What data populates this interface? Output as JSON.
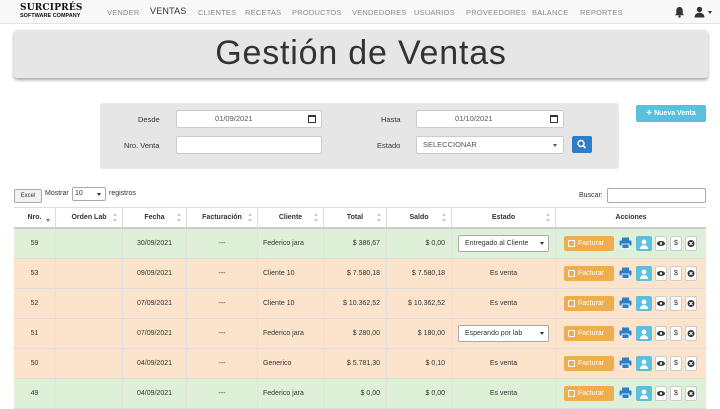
{
  "brand": {
    "name": "SURCIPRÉS",
    "tagline": "SOFTWARE COMPANY"
  },
  "nav": {
    "items": [
      {
        "label": "VENDER",
        "active": false
      },
      {
        "label": "VENTAS",
        "active": true
      },
      {
        "label": "CLIENTES",
        "active": false
      },
      {
        "label": "RECETAS",
        "active": false
      },
      {
        "label": "PRODUCTOS",
        "active": false
      },
      {
        "label": "VENDEDORES",
        "active": false
      },
      {
        "label": "USUARIOS",
        "active": false
      },
      {
        "label": "PROVEEDORES",
        "active": false
      },
      {
        "label": "BALANCE",
        "active": false
      },
      {
        "label": "REPORTES",
        "active": false
      }
    ],
    "icons": [
      "bell-icon",
      "user-icon",
      "caret-down-icon"
    ]
  },
  "page": {
    "title": "Gestión de Ventas"
  },
  "filters": {
    "desde_label": "Desde",
    "desde_value": "01/09/2021",
    "hasta_label": "Hasta",
    "hasta_value": "01/10/2021",
    "nro_venta_label": "Nro. Venta",
    "nro_venta_value": "",
    "estado_label": "Estado",
    "estado_value": "SELECCIONAR"
  },
  "actions": {
    "nueva_venta": "Nueva Venta"
  },
  "table_controls": {
    "excel": "Excel",
    "mostrar": "Mostrar",
    "page_size": "10",
    "registros": "registros",
    "buscar": "Buscar:"
  },
  "table": {
    "columns": [
      "Nro.",
      "Orden Lab",
      "Fecha",
      "Facturación",
      "Cliente",
      "Total",
      "Saldo",
      "Estado",
      "Acciones"
    ],
    "rows": [
      {
        "nro": "59",
        "orden_lab": "",
        "fecha": "30/09/2021",
        "facturacion": "---",
        "cliente": "Federico jara",
        "total": "$ 386,67",
        "saldo": "$ 0,00",
        "estado": "Entregado al Cliente",
        "estado_type": "select",
        "color": "green"
      },
      {
        "nro": "53",
        "orden_lab": "",
        "fecha": "09/09/2021",
        "facturacion": "---",
        "cliente": "Cliente 10",
        "total": "$ 7.580,18",
        "saldo": "$ 7.580,18",
        "estado": "Es venta",
        "estado_type": "text",
        "color": "orange"
      },
      {
        "nro": "52",
        "orden_lab": "",
        "fecha": "07/09/2021",
        "facturacion": "---",
        "cliente": "Cliente 10",
        "total": "$ 10.362,52",
        "saldo": "$ 10.362,52",
        "estado": "Es venta",
        "estado_type": "text",
        "color": "orange"
      },
      {
        "nro": "51",
        "orden_lab": "",
        "fecha": "07/09/2021",
        "facturacion": "---",
        "cliente": "Federico jara",
        "total": "$ 280,00",
        "saldo": "$ 180,00",
        "estado": "Esperando por lab",
        "estado_type": "select",
        "color": "orange"
      },
      {
        "nro": "50",
        "orden_lab": "",
        "fecha": "04/09/2021",
        "facturacion": "---",
        "cliente": "Generico",
        "total": "$ 5.781,30",
        "saldo": "$ 0,10",
        "estado": "Es venta",
        "estado_type": "text",
        "color": "orange"
      },
      {
        "nro": "49",
        "orden_lab": "",
        "fecha": "04/09/2021",
        "facturacion": "---",
        "cliente": "Federico jara",
        "total": "$ 0,00",
        "saldo": "$ 0,00",
        "estado": "Es venta",
        "estado_type": "text",
        "color": "green"
      }
    ],
    "row_actions": {
      "facturar": "Facturar",
      "dollar": "$"
    }
  },
  "colors": {
    "accent_blue": "#2d7ec6",
    "info": "#5bc0de",
    "warning": "#f0ad4e",
    "row_green": "#dff0d8",
    "row_orange": "#fce4cc"
  }
}
